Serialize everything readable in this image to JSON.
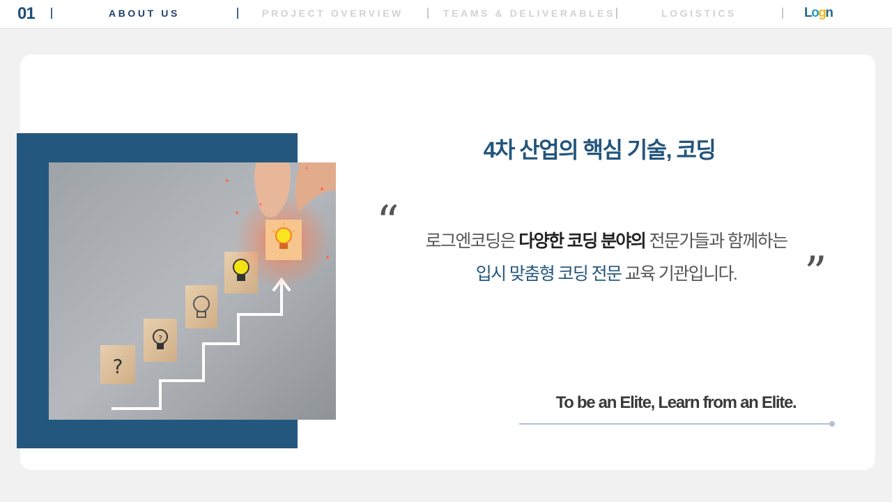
{
  "nav": {
    "page_number": "01",
    "items": [
      {
        "label": "ABOUT US",
        "active": true
      },
      {
        "label": "PROJECT OVERVIEW",
        "active": false
      },
      {
        "label": "TEAMS & DELIVERABLES",
        "active": false
      },
      {
        "label": "LOGISTICS",
        "active": false
      }
    ],
    "logo": "Logn"
  },
  "main": {
    "headline": "4차 산업의 핵심 기술, 코딩",
    "quote_open": "“",
    "quote_close": "”",
    "line1": {
      "part1": "로그엔코딩은 ",
      "part2": "다양한 코딩 분야의",
      "part3": " 전문가들과 함께하는"
    },
    "line2": {
      "part1": "입시 맞춤형 코딩 전문",
      "part2": " 교육 기관입니다."
    },
    "slogan": "To be an Elite, Learn from an Elite."
  },
  "illustration": {
    "block_labels": [
      "?",
      "?"
    ]
  },
  "colors": {
    "accent": "#24577e",
    "navy": "#1f3e6a",
    "logo_teal": "#1f6a86",
    "logo_yellow": "#f0b81b"
  }
}
